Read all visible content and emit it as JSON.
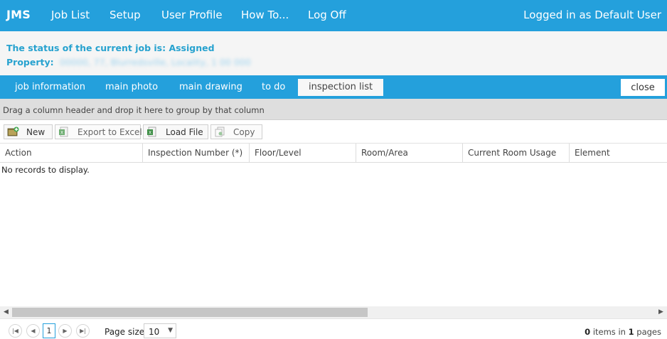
{
  "nav": {
    "brand": "JMS",
    "items": [
      "Job List",
      "Setup",
      "User Profile",
      "How To...",
      "Log Off"
    ],
    "user_text": "Logged in as Default User"
  },
  "status": {
    "status_text": "The status of the current job is: Assigned",
    "property_label": "Property:",
    "property_value": "00000, 77, Blurredsville, Locality, 1 00 000"
  },
  "tabs": {
    "items": [
      "job information",
      "main photo",
      "main drawing",
      "to do",
      "inspection list"
    ],
    "active": "inspection list",
    "close_label": "close"
  },
  "grid": {
    "group_hint": "Drag a column header and drop it here to group by that column",
    "toolbar": {
      "new_label": "New",
      "export_label": "Export to Excel",
      "load_label": "Load File",
      "copy_label": "Copy"
    },
    "columns": [
      "Action",
      "Inspection Number (*)",
      "Floor/Level",
      "Room/Area",
      "Current Room Usage",
      "Element"
    ],
    "no_records": "No records to display.",
    "pager": {
      "current_page": "1",
      "page_size_label": "Page size:",
      "page_size": "10",
      "items_count": "0",
      "items_text": "items in",
      "pages_count": "1",
      "pages_text": "pages"
    }
  },
  "colors": {
    "accent": "#24a0dc",
    "status_text": "#27a2cf"
  }
}
